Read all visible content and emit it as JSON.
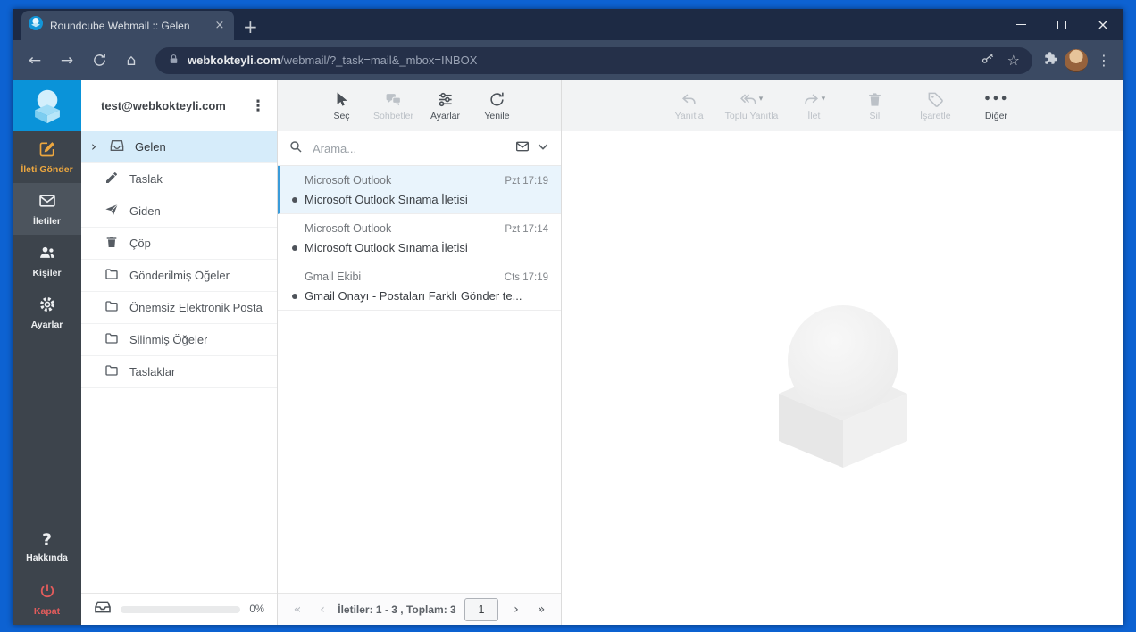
{
  "chrome": {
    "tab_title": "Roundcube Webmail :: Gelen",
    "url_host": "webkokteyli.com",
    "url_path": "/webmail/?_task=mail&_mbox=INBOX"
  },
  "icons": {
    "back": "←",
    "forward": "→",
    "home": "⌂",
    "star": "☆",
    "menu": "⋮",
    "kebab": "⋮",
    "new_tab": "+",
    "tab_close": "×",
    "close": "×",
    "collapse": "›",
    "first": "«",
    "prev": "‹",
    "next": "›",
    "last": "»",
    "caret": "▾",
    "more": "•••",
    "help": "?"
  },
  "sidebar": {
    "compose": "İleti Gönder",
    "mail": "İletiler",
    "contacts": "Kişiler",
    "settings": "Ayarlar",
    "about": "Hakkında",
    "logout": "Kapat"
  },
  "folders": {
    "account": "test@webkokteyli.com",
    "items": [
      {
        "label": "Gelen"
      },
      {
        "label": "Taslak"
      },
      {
        "label": "Giden"
      },
      {
        "label": "Çöp"
      },
      {
        "label": "Gönderilmiş Öğeler"
      },
      {
        "label": "Önemsiz Elektronik Posta"
      },
      {
        "label": "Silinmiş Öğeler"
      },
      {
        "label": "Taslaklar"
      }
    ],
    "quota": "0%"
  },
  "list_toolbar": {
    "select": "Seç",
    "chats": "Sohbetler",
    "options": "Ayarlar",
    "refresh": "Yenile"
  },
  "search": {
    "placeholder": "Arama..."
  },
  "messages": [
    {
      "sender": "Microsoft Outlook",
      "date": "Pzt 17:19",
      "subject": "Microsoft Outlook Sınama İletisi"
    },
    {
      "sender": "Microsoft Outlook",
      "date": "Pzt 17:14",
      "subject": "Microsoft Outlook Sınama İletisi"
    },
    {
      "sender": "Gmail Ekibi",
      "date": "Cts 17:19",
      "subject": "Gmail Onayı - Postaları Farklı Gönder te..."
    }
  ],
  "pager": {
    "status": "İletiler: 1 - 3 , Toplam: 3",
    "page": "1"
  },
  "mail_toolbar": {
    "reply": "Yanıtla",
    "reply_all": "Toplu Yanıtla",
    "forward": "İlet",
    "delete": "Sil",
    "mark": "İşaretle",
    "more": "Diğer"
  }
}
